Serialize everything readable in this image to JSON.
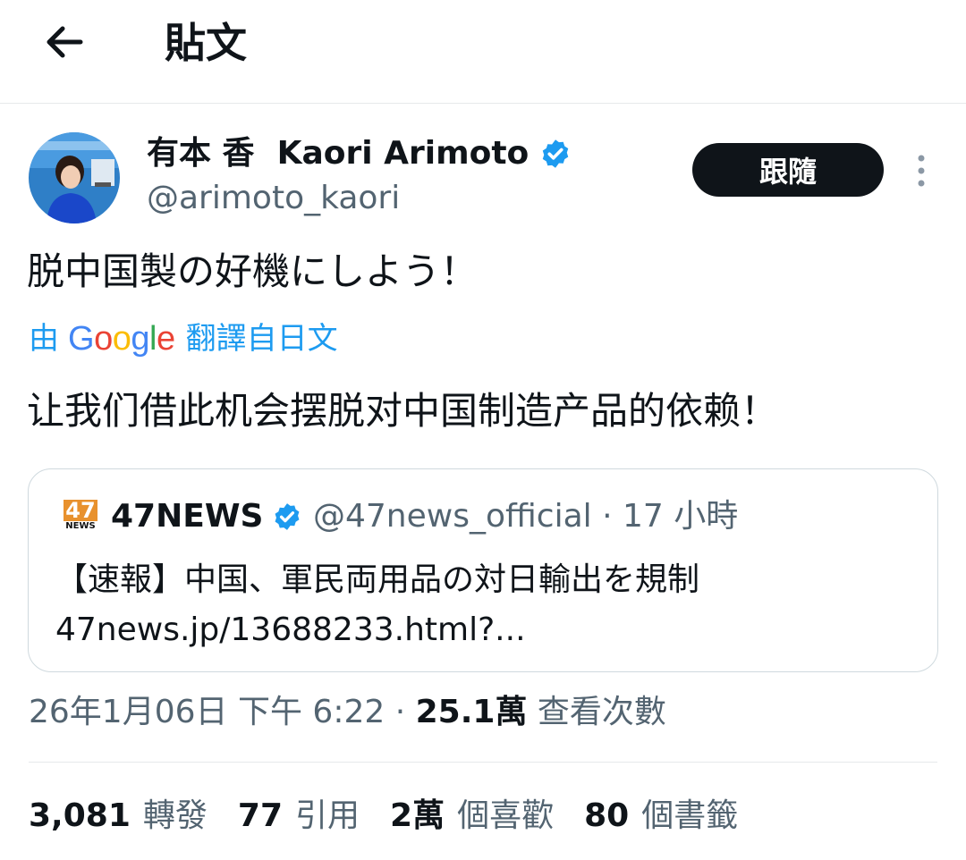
{
  "header": {
    "title": "貼文",
    "back_icon": "arrow-left-icon"
  },
  "author": {
    "display_name": "有本 香  Kaori Arimoto",
    "handle": "@arimoto_kaori",
    "verified": true,
    "verified_color": "#1d9bf0"
  },
  "follow_label": "跟隨",
  "tweet": {
    "text": "脱中国製の好機にしよう！"
  },
  "translation": {
    "prefix": "由",
    "provider": "Google",
    "suffix": "翻譯自日文",
    "text": "让我们借此机会摆脱对中国制造产品的依赖！"
  },
  "quote": {
    "logo_number": "47",
    "logo_text": "NEWS",
    "name": "47NEWS",
    "handle": "@47news_official",
    "separator": "·",
    "age": "17 小時",
    "text": "【速報】中国、軍民両用品の対日輸出を規制",
    "link": "47news.jp/13688233.html?..."
  },
  "timestamp": {
    "date_time": "26年1月06日 下午 6:22",
    "separator": "·",
    "views_count": "25.1萬",
    "views_label": "查看次數"
  },
  "stats": [
    {
      "count": "3,081",
      "label": "轉發"
    },
    {
      "count": "77",
      "label": "引用"
    },
    {
      "count": "2萬",
      "label": "個喜歡"
    },
    {
      "count": "80",
      "label": "個書籤"
    }
  ],
  "colors": {
    "accent": "#1d9bf0",
    "text_primary": "#0f1419",
    "text_secondary": "#536471",
    "border": "#cfd9de"
  }
}
